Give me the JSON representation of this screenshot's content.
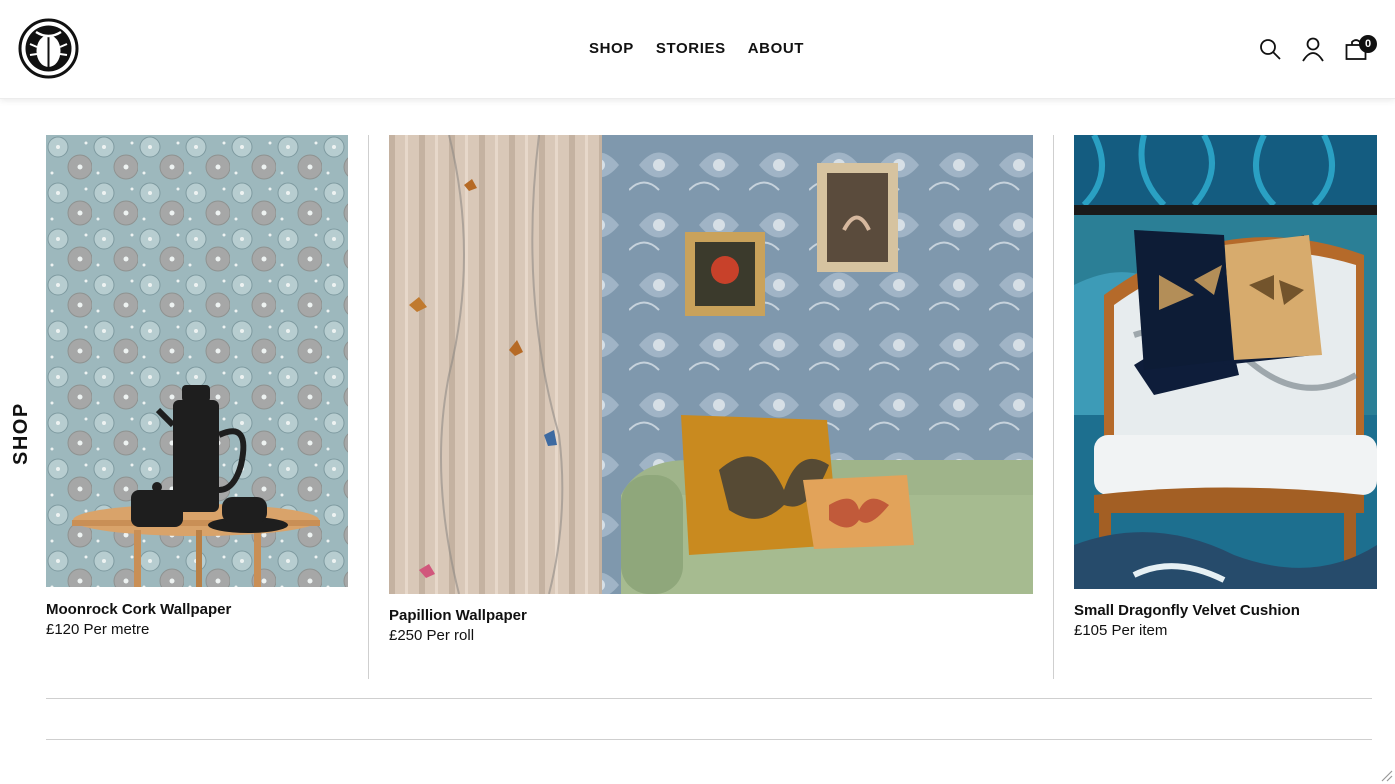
{
  "header": {
    "nav": [
      {
        "label": "SHOP"
      },
      {
        "label": "STORIES"
      },
      {
        "label": "ABOUT"
      }
    ],
    "icons": {
      "search": "search-icon",
      "account": "user-icon",
      "cart": "bag-icon"
    },
    "cart_count": "0"
  },
  "side_label": "SHOP",
  "products": [
    {
      "title": "Moonrock Cork Wallpaper",
      "price": "£120 Per metre"
    },
    {
      "title": "Papillion Wallpaper",
      "price": "£250 Per roll"
    },
    {
      "title": "Small Dragonfly Velvet Cushion",
      "price": "£105 Per item"
    }
  ],
  "colors": {
    "text": "#111111",
    "divider": "#cfcfcf",
    "background": "#ffffff"
  }
}
